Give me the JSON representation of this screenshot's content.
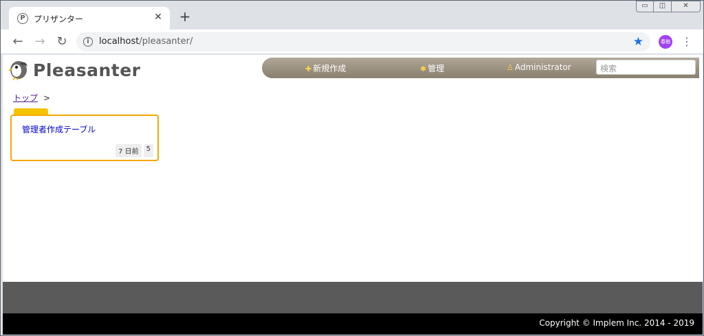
{
  "browser": {
    "tab": {
      "favicon": "P",
      "title": "プリザンター"
    },
    "window_controls": [
      "minimize-icon",
      "restore-icon",
      "close-icon"
    ],
    "url": {
      "host": "localhost",
      "path": "/pleasanter/"
    },
    "profile_initials": "春樹"
  },
  "app": {
    "logo_text": "Pleasanter",
    "nav": {
      "new_label": "新規作成",
      "manage_label": "管理",
      "user_label": "Administrator",
      "search_placeholder": "検索"
    },
    "breadcrumb": {
      "top_label": "トップ",
      "separator": ">"
    },
    "sites": [
      {
        "title": "管理者作成テーブル",
        "updated": "7 日前",
        "count": "5"
      }
    ],
    "footer": {
      "copyright": "Copyright © Implem Inc. 2014 - 2019"
    }
  },
  "colors": {
    "accent_card_border": "#f5a700",
    "navbar": "#9a907f",
    "profile": "#a142f4",
    "star": "#1a73e8"
  }
}
